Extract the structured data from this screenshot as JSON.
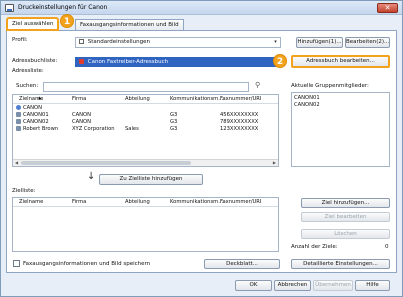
{
  "window": {
    "title": "Druckeinstellungen für Canon",
    "close_glyph": "✕"
  },
  "tabs": [
    {
      "label": "Ziel auswählen",
      "active": true
    },
    {
      "label": "Faxausgangsinformationen und Bild",
      "active": false
    }
  ],
  "callouts": {
    "one": "1",
    "two": "2"
  },
  "profile": {
    "label": "Profil:",
    "value": "Standardeinstellungen",
    "add_button": "Hinzufügen(1)...",
    "edit_button": "Bearbeiten(2)..."
  },
  "addressbook": {
    "label": "Adressbuchliste:",
    "value": "Canon Faxtreiber-Adressbuch",
    "edit_button": "Adressbuch bearbeiten...",
    "list_label": "Adressliste:",
    "search_label": "Suchen:",
    "search_value": ""
  },
  "address_table": {
    "columns": [
      "Zielname",
      "Firma",
      "Abteilung",
      "Kommunikationsm...",
      "Faxnummer/URI"
    ],
    "rows": [
      {
        "name": "CANON",
        "company": "",
        "department": "",
        "comm": "",
        "fax": "",
        "group": true
      },
      {
        "name": "CANON01",
        "company": "CANON",
        "department": "",
        "comm": "G3",
        "fax": "456XXXXXXXX",
        "group": false
      },
      {
        "name": "CANON02",
        "company": "CANON",
        "department": "",
        "comm": "G3",
        "fax": "789XXXXXXXX",
        "group": false
      },
      {
        "name": "Robert Brown",
        "company": "XYZ Corporation",
        "department": "Sales",
        "comm": "G3",
        "fax": "123XXXXXXXX",
        "group": false
      }
    ]
  },
  "group_members": {
    "label": "Aktuelle Gruppenmitglieder:",
    "items": [
      "CANON01",
      "CANON02"
    ]
  },
  "add_to_list_button": "Zu Zielliste hinzufügen",
  "target_list": {
    "label": "Zielliste:",
    "columns": [
      "Zielname",
      "Firma",
      "Abteilung",
      "Kommunikationsm...",
      "Faxnummer/URI"
    ]
  },
  "target_buttons": {
    "add": "Ziel hinzufügen...",
    "edit": "Ziel bearbeiten",
    "delete": "Löschen",
    "count_label": "Anzahl der Ziele:",
    "count_value": "0"
  },
  "bottom": {
    "checkbox_label": "Faxausgangsinformationen und Bild speichern",
    "cover_button": "Deckblatt...",
    "details_button": "Detaillierte Einstellungen..."
  },
  "footer": {
    "ok": "OK",
    "cancel": "Abbrechen",
    "apply": "Übernehmen",
    "help": "Hilfe"
  }
}
